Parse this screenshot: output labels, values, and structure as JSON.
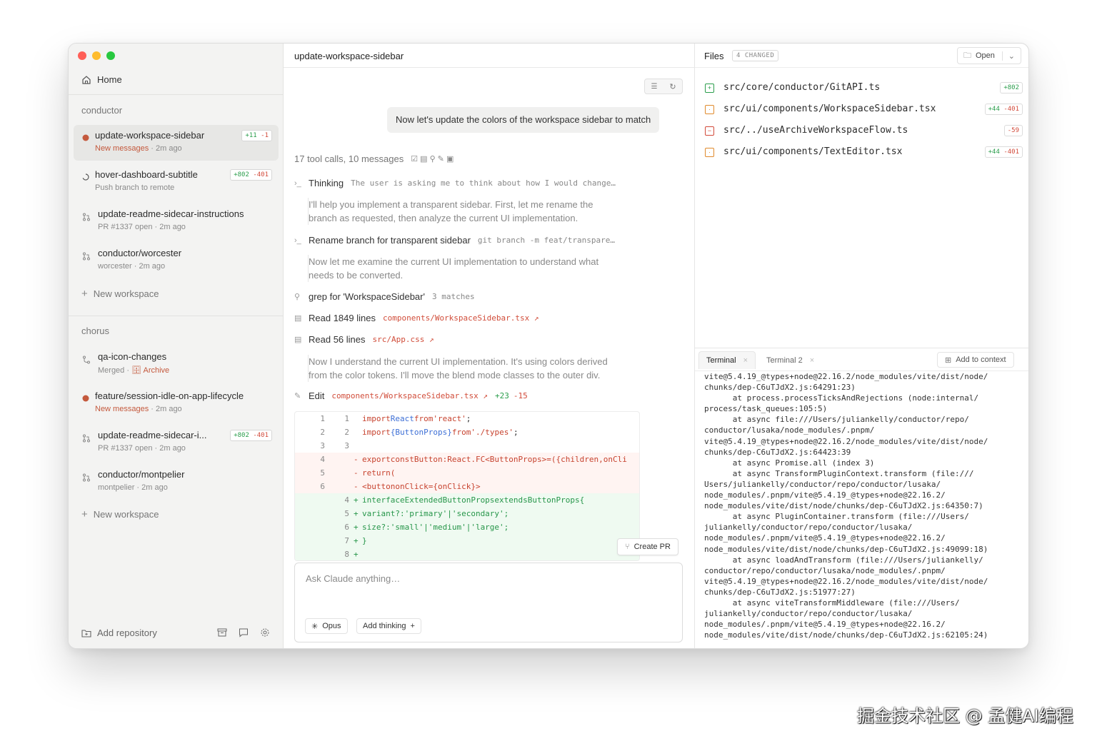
{
  "colors": {
    "traffic_close": "#ff5f57",
    "traffic_min": "#febc2e",
    "traffic_max": "#28c840",
    "accent_red": "#c4593d",
    "add_green": "#2a9d4b",
    "del_red": "#d24a3a"
  },
  "sidebar": {
    "home_label": "Home",
    "groups": [
      {
        "label": "conductor",
        "items": [
          {
            "title": "update-workspace-sidebar",
            "status": "New messages",
            "time": "2m ago",
            "add": "+11",
            "del": "-1"
          },
          {
            "title": "hover-dashboard-subtitle",
            "status": "Push branch to remote",
            "add": "+802",
            "del": "-401"
          },
          {
            "title": "update-readme-sidecar-instructions",
            "status": "PR #1337 open",
            "time": "2m ago"
          },
          {
            "title": "conductor/worcester",
            "status": "worcester",
            "time": "2m ago"
          }
        ],
        "new_label": "New workspace"
      },
      {
        "label": "chorus",
        "items": [
          {
            "title": "qa-icon-changes",
            "status": "Merged",
            "archive": "Archive"
          },
          {
            "title": "feature/session-idle-on-app-lifecycle",
            "status": "New messages",
            "time": "2m ago"
          },
          {
            "title": "update-readme-sidecar-i...",
            "status": "PR #1337 open",
            "time": "2m ago",
            "add": "+802",
            "del": "-401"
          },
          {
            "title": "conductor/montpelier",
            "status": "montpelier",
            "time": "2m ago"
          }
        ],
        "new_label": "New workspace"
      }
    ],
    "add_repo_label": "Add repository"
  },
  "chat": {
    "title": "update-workspace-sidebar",
    "user_message": "Now let's update the colors of the workspace sidebar to match",
    "summary": "17 tool calls, 10 messages",
    "thinking_label": "Thinking",
    "thinking_text": "The user is asking me to think about how I would change…",
    "para1": [
      "I'll help you implement a transparent sidebar. First, let me rename the",
      "branch as requested, then analyze the current UI implementation."
    ],
    "rename_label": "Rename branch for transparent sidebar",
    "rename_cmd": "git branch -m feat/transpare…",
    "para2": [
      "Now let me examine the current UI implementation to understand what",
      "needs to be converted."
    ],
    "grep_label": "grep for 'WorkspaceSidebar'",
    "grep_matches": "3 matches",
    "read1_label": "Read 1849 lines",
    "read1_file": "components/WorkspaceSidebar.tsx ↗",
    "read2_label": "Read 56 lines",
    "read2_file": "src/App.css ↗",
    "para3": [
      "Now I understand the current UI implementation. It's using colors derived",
      "from the color tokens. I'll move the blend mode classes to the outer div."
    ],
    "edit_label": "Edit",
    "edit_file": "components/WorkspaceSidebar.tsx ↗",
    "edit_add": "+23",
    "edit_del": "-15",
    "create_pr": "Create PR",
    "input_placeholder": "Ask Claude anything…",
    "model_label": "Opus",
    "thinking_btn": "Add thinking"
  },
  "code_lines": [
    {
      "n1": "1",
      "n2": "1",
      "type": "ctx",
      "mk": "",
      "text": "importReactfrom'react';"
    },
    {
      "n1": "2",
      "n2": "2",
      "type": "ctx",
      "mk": "",
      "text": "import{ButtonProps}from'./types';"
    },
    {
      "n1": "3",
      "n2": "3",
      "type": "ctx",
      "mk": "",
      "text": ""
    },
    {
      "n1": "4",
      "n2": "",
      "type": "del",
      "mk": "-",
      "text": "exportconstButton:React.FC<ButtonProps>=({children,onCli"
    },
    {
      "n1": "5",
      "n2": "",
      "type": "del",
      "mk": "-",
      "text": "return("
    },
    {
      "n1": "6",
      "n2": "",
      "type": "del",
      "mk": "-",
      "text": "<buttononClick={onClick}>"
    },
    {
      "n1": "",
      "n2": "4",
      "type": "add",
      "mk": "+",
      "text": "interfaceExtendedButtonPropsextendsButtonProps{"
    },
    {
      "n1": "",
      "n2": "5",
      "type": "add",
      "mk": "+",
      "text": "variant?:'primary'|'secondary';"
    },
    {
      "n1": "",
      "n2": "6",
      "type": "add",
      "mk": "+",
      "text": "size?:'small'|'medium'|'large';"
    },
    {
      "n1": "",
      "n2": "7",
      "type": "add",
      "mk": "+",
      "text": "}"
    },
    {
      "n1": "",
      "n2": "8",
      "type": "add",
      "mk": "+",
      "text": ""
    }
  ],
  "files": {
    "title": "Files",
    "changed": "4 CHANGED",
    "open_label": "Open",
    "list": [
      {
        "name": "src/core/conductor/GitAPI.ts",
        "status": "added",
        "diff": "+802"
      },
      {
        "name": "src/ui/components/WorkspaceSidebar.tsx",
        "status": "modified",
        "add": "+44",
        "del": "-401"
      },
      {
        "name": "src/../useArchiveWorkspaceFlow.ts",
        "status": "deleted",
        "diff": "-59"
      },
      {
        "name": "src/ui/components/TextEditor.tsx",
        "status": "modified",
        "add": "+44",
        "del": "-401"
      }
    ]
  },
  "terminal": {
    "tabs": [
      "Terminal",
      "Terminal 2"
    ],
    "add_context": "Add to context",
    "lines": [
      "vite@5.4.19_@types+node@22.16.2/node_modules/vite/dist/node/",
      "chunks/dep-C6uTJdX2.js:64291:23)",
      "      at process.processTicksAndRejections (node:internal/",
      "process/task_queues:105:5)",
      "      at async file:///Users/juliankelly/conductor/repo/",
      "conductor/lusaka/node_modules/.pnpm/",
      "vite@5.4.19_@types+node@22.16.2/node_modules/vite/dist/node/",
      "chunks/dep-C6uTJdX2.js:64423:39",
      "      at async Promise.all (index 3)",
      "      at async TransformPluginContext.transform (file:///",
      "Users/juliankelly/conductor/repo/conductor/lusaka/",
      "node_modules/.pnpm/vite@5.4.19_@types+node@22.16.2/",
      "node_modules/vite/dist/node/chunks/dep-C6uTJdX2.js:64350:7)",
      "      at async PluginContainer.transform (file:///Users/",
      "juliankelly/conductor/repo/conductor/lusaka/",
      "node_modules/.pnpm/vite@5.4.19_@types+node@22.16.2/",
      "node_modules/vite/dist/node/chunks/dep-C6uTJdX2.js:49099:18)",
      "      at async loadAndTransform (file:///Users/juliankelly/",
      "conductor/repo/conductor/lusaka/node_modules/.pnpm/",
      "vite@5.4.19_@types+node@22.16.2/node_modules/vite/dist/node/",
      "chunks/dep-C6uTJdX2.js:51977:27)",
      "      at async viteTransformMiddleware (file:///Users/",
      "juliankelly/conductor/repo/conductor/lusaka/",
      "node_modules/.pnpm/vite@5.4.19_@types+node@22.16.2/",
      "node_modules/vite/dist/node/chunks/dep-C6uTJdX2.js:62105:24)"
    ]
  },
  "watermark": "掘金技术社区 @ 孟健AI编程"
}
